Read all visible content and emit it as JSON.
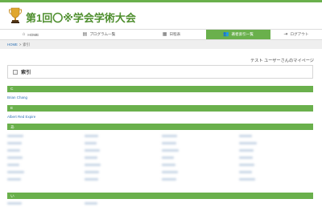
{
  "header": {
    "title": "第1回〇※学会学術大会",
    "logo_icon": "trophy-icon"
  },
  "nav": {
    "items": [
      {
        "label": "HOME",
        "icon": "home-icon",
        "glyph": "⌂",
        "active": false
      },
      {
        "label": "プログラム一覧",
        "icon": "list-icon",
        "glyph": "▤",
        "active": false
      },
      {
        "label": "日程表",
        "icon": "calendar-icon",
        "glyph": "▦",
        "active": false
      },
      {
        "label": "著者索引一覧",
        "icon": "users-icon",
        "glyph": "👥",
        "active": true
      },
      {
        "label": "ログアウト",
        "icon": "logout-icon",
        "glyph": "⇥",
        "active": false
      }
    ]
  },
  "breadcrumb": {
    "home": "HOME",
    "separator": ">",
    "current": "索引"
  },
  "user_message": "テスト ユーザーさんのマイページ",
  "page_heading": {
    "title": "索引"
  },
  "sections": [
    {
      "letter": "C",
      "entries": [
        "Brian Chang"
      ]
    },
    {
      "letter": "E",
      "entries": [
        "Albert Red Expire"
      ]
    },
    {
      "letter": "あ",
      "entries": []
    },
    {
      "letter": "い",
      "entries": []
    }
  ],
  "colors": {
    "accent": "#6ab04c",
    "title": "#4f8f2f",
    "link": "#2f72b5"
  }
}
